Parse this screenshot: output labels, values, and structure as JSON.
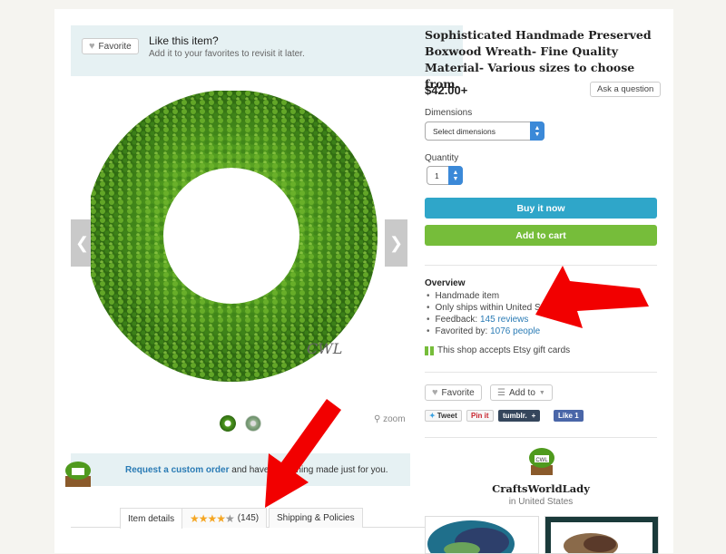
{
  "favorite_banner": {
    "button_label": "Favorite",
    "title": "Like this item?",
    "subtitle": "Add it to your favorites to revisit it later."
  },
  "gallery": {
    "watermark": "CWL",
    "zoom_label": "zoom"
  },
  "custom_order": {
    "link_text": "Request a custom order",
    "rest_text": " and have something made just for you."
  },
  "tabs": {
    "item_details": "Item details",
    "reviews_count": "(145)",
    "rating_stars": 4,
    "shipping": "Shipping & Policies"
  },
  "listing": {
    "title": "Sophisticated Handmade Preserved Boxwood Wreath- Fine Quality Material- Various sizes to choose from.",
    "price": "$42.00+",
    "ask_button": "Ask a question",
    "dimensions_label": "Dimensions",
    "dimensions_value": "Select dimensions",
    "quantity_label": "Quantity",
    "quantity_value": "1",
    "buy_now": "Buy it now",
    "add_to_cart": "Add to cart"
  },
  "overview": {
    "title": "Overview",
    "item_1": "Handmade item",
    "item_2": "Only ships within United States.",
    "feedback_label": "Feedback: ",
    "feedback_link": "145 reviews",
    "favorited_label": "Favorited by: ",
    "favorited_link": "1076 people",
    "gift_cards": "This shop accepts Etsy gift cards"
  },
  "actions": {
    "favorite": "Favorite",
    "add_to": "Add to"
  },
  "share": {
    "tweet": "Tweet",
    "pinit": "Pin it",
    "tumblr": "tumblr.",
    "plus": "+",
    "like": "Like 1"
  },
  "shop": {
    "avatar_text": "CWL",
    "name": "CraftsWorldLady",
    "location": "in United States"
  },
  "colors": {
    "buy_now": "#2fa6c9",
    "add_to_cart": "#76bd3a",
    "link": "#2a7bb5",
    "banner": "#e6f1f3",
    "annotation_arrow": "#f20000"
  }
}
